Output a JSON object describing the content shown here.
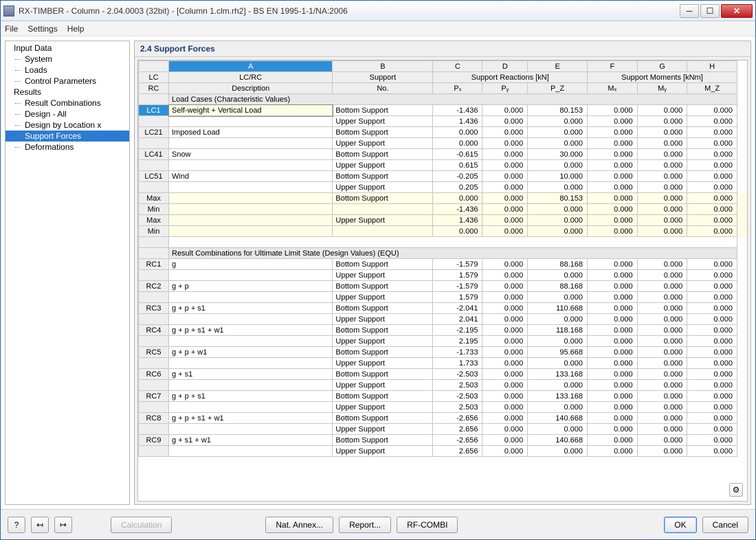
{
  "title": "RX-TIMBER - Column - 2.04.0003 (32bit) - [Column 1.clm.rh2] - BS EN 1995-1-1/NA:2006",
  "menu": {
    "file": "File",
    "settings": "Settings",
    "help": "Help"
  },
  "tree": {
    "input": "Input Data",
    "system": "System",
    "loads": "Loads",
    "control": "Control Parameters",
    "results": "Results",
    "rc": "Result Combinations",
    "designall": "Design - All",
    "designloc": "Design by Location x",
    "support": "Support Forces",
    "deform": "Deformations"
  },
  "panel_title": "2.4 Support Forces",
  "chart_data": {
    "type": "table",
    "header_top": {
      "lc": "LC",
      "rc": "RC",
      "lcrc": "LC/RC",
      "desc": "Description",
      "support": "Support",
      "no": "No.",
      "reactions": "Support Reactions [kN]",
      "moments": "Support Moments [kNm]"
    },
    "header_sub": {
      "px": "Pₓ",
      "py": "Pᵧ",
      "pz": "P_Z",
      "mx": "Mₓ",
      "my": "Mᵧ",
      "mz": "M_Z"
    },
    "col_letters": [
      "A",
      "B",
      "C",
      "D",
      "E",
      "F",
      "G",
      "H"
    ],
    "section1": "Load Cases (Characteristic Values)",
    "section2": "Result Combinations for Ultimate Limit State (Design Values) (EQU)",
    "rows1": [
      {
        "id": "LC1",
        "sel": true,
        "desc": "Self-weight + Vertical Load",
        "sup": "Bottom Support",
        "v": [
          "-1.436",
          "0.000",
          "80.153",
          "0.000",
          "0.000",
          "0.000"
        ]
      },
      {
        "id": "",
        "desc": "",
        "sup": "Upper Support",
        "v": [
          "1.436",
          "0.000",
          "0.000",
          "0.000",
          "0.000",
          "0.000"
        ]
      },
      {
        "id": "LC21",
        "desc": "Imposed Load",
        "sup": "Bottom Support",
        "v": [
          "0.000",
          "0.000",
          "0.000",
          "0.000",
          "0.000",
          "0.000"
        ]
      },
      {
        "id": "",
        "desc": "",
        "sup": "Upper Support",
        "v": [
          "0.000",
          "0.000",
          "0.000",
          "0.000",
          "0.000",
          "0.000"
        ]
      },
      {
        "id": "LC41",
        "desc": "Snow",
        "sup": "Bottom Support",
        "v": [
          "-0.615",
          "0.000",
          "30.000",
          "0.000",
          "0.000",
          "0.000"
        ]
      },
      {
        "id": "",
        "desc": "",
        "sup": "Upper Support",
        "v": [
          "0.615",
          "0.000",
          "0.000",
          "0.000",
          "0.000",
          "0.000"
        ]
      },
      {
        "id": "LC51",
        "desc": "Wind",
        "sup": "Bottom Support",
        "v": [
          "-0.205",
          "0.000",
          "10.000",
          "0.000",
          "0.000",
          "0.000"
        ]
      },
      {
        "id": "",
        "desc": "",
        "sup": "Upper Support",
        "v": [
          "0.205",
          "0.000",
          "0.000",
          "0.000",
          "0.000",
          "0.000"
        ]
      },
      {
        "id": "Max",
        "mm": true,
        "desc": "",
        "sup": "Bottom Support",
        "v": [
          "0.000",
          "0.000",
          "80.153",
          "0.000",
          "0.000",
          "0.000"
        ]
      },
      {
        "id": "Min",
        "mm": true,
        "desc": "",
        "sup": "",
        "v": [
          "-1.436",
          "0.000",
          "0.000",
          "0.000",
          "0.000",
          "0.000"
        ]
      },
      {
        "id": "Max",
        "mm": true,
        "desc": "",
        "sup": "Upper Support",
        "v": [
          "1.436",
          "0.000",
          "0.000",
          "0.000",
          "0.000",
          "0.000"
        ]
      },
      {
        "id": "Min",
        "mm": true,
        "desc": "",
        "sup": "",
        "v": [
          "0.000",
          "0.000",
          "0.000",
          "0.000",
          "0.000",
          "0.000"
        ]
      }
    ],
    "rows2": [
      {
        "id": "RC1",
        "desc": "g",
        "sup": "Bottom Support",
        "v": [
          "-1.579",
          "0.000",
          "88.168",
          "0.000",
          "0.000",
          "0.000"
        ]
      },
      {
        "id": "",
        "desc": "",
        "sup": "Upper Support",
        "v": [
          "1.579",
          "0.000",
          "0.000",
          "0.000",
          "0.000",
          "0.000"
        ]
      },
      {
        "id": "RC2",
        "desc": "g + p",
        "sup": "Bottom Support",
        "v": [
          "-1.579",
          "0.000",
          "88.168",
          "0.000",
          "0.000",
          "0.000"
        ]
      },
      {
        "id": "",
        "desc": "",
        "sup": "Upper Support",
        "v": [
          "1.579",
          "0.000",
          "0.000",
          "0.000",
          "0.000",
          "0.000"
        ]
      },
      {
        "id": "RC3",
        "desc": "g + p + s1",
        "sup": "Bottom Support",
        "v": [
          "-2.041",
          "0.000",
          "110.668",
          "0.000",
          "0.000",
          "0.000"
        ]
      },
      {
        "id": "",
        "desc": "",
        "sup": "Upper Support",
        "v": [
          "2.041",
          "0.000",
          "0.000",
          "0.000",
          "0.000",
          "0.000"
        ]
      },
      {
        "id": "RC4",
        "desc": "g + p + s1 + w1",
        "sup": "Bottom Support",
        "v": [
          "-2.195",
          "0.000",
          "118.168",
          "0.000",
          "0.000",
          "0.000"
        ]
      },
      {
        "id": "",
        "desc": "",
        "sup": "Upper Support",
        "v": [
          "2.195",
          "0.000",
          "0.000",
          "0.000",
          "0.000",
          "0.000"
        ]
      },
      {
        "id": "RC5",
        "desc": "g + p + w1",
        "sup": "Bottom Support",
        "v": [
          "-1.733",
          "0.000",
          "95.668",
          "0.000",
          "0.000",
          "0.000"
        ]
      },
      {
        "id": "",
        "desc": "",
        "sup": "Upper Support",
        "v": [
          "1.733",
          "0.000",
          "0.000",
          "0.000",
          "0.000",
          "0.000"
        ]
      },
      {
        "id": "RC6",
        "desc": "g + s1",
        "sup": "Bottom Support",
        "v": [
          "-2.503",
          "0.000",
          "133.168",
          "0.000",
          "0.000",
          "0.000"
        ]
      },
      {
        "id": "",
        "desc": "",
        "sup": "Upper Support",
        "v": [
          "2.503",
          "0.000",
          "0.000",
          "0.000",
          "0.000",
          "0.000"
        ]
      },
      {
        "id": "RC7",
        "desc": "g + p + s1",
        "sup": "Bottom Support",
        "v": [
          "-2.503",
          "0.000",
          "133.168",
          "0.000",
          "0.000",
          "0.000"
        ]
      },
      {
        "id": "",
        "desc": "",
        "sup": "Upper Support",
        "v": [
          "2.503",
          "0.000",
          "0.000",
          "0.000",
          "0.000",
          "0.000"
        ]
      },
      {
        "id": "RC8",
        "desc": "g + p + s1 + w1",
        "sup": "Bottom Support",
        "v": [
          "-2.656",
          "0.000",
          "140.668",
          "0.000",
          "0.000",
          "0.000"
        ]
      },
      {
        "id": "",
        "desc": "",
        "sup": "Upper Support",
        "v": [
          "2.656",
          "0.000",
          "0.000",
          "0.000",
          "0.000",
          "0.000"
        ]
      },
      {
        "id": "RC9",
        "desc": "g + s1 + w1",
        "sup": "Bottom Support",
        "v": [
          "-2.656",
          "0.000",
          "140.668",
          "0.000",
          "0.000",
          "0.000"
        ]
      },
      {
        "id": "",
        "desc": "",
        "sup": "Upper Support",
        "v": [
          "2.656",
          "0.000",
          "0.000",
          "0.000",
          "0.000",
          "0.000"
        ]
      }
    ]
  },
  "buttons": {
    "calc": "Calculation",
    "nat": "Nat. Annex...",
    "report": "Report...",
    "rfcombi": "RF-COMBI",
    "ok": "OK",
    "cancel": "Cancel"
  }
}
